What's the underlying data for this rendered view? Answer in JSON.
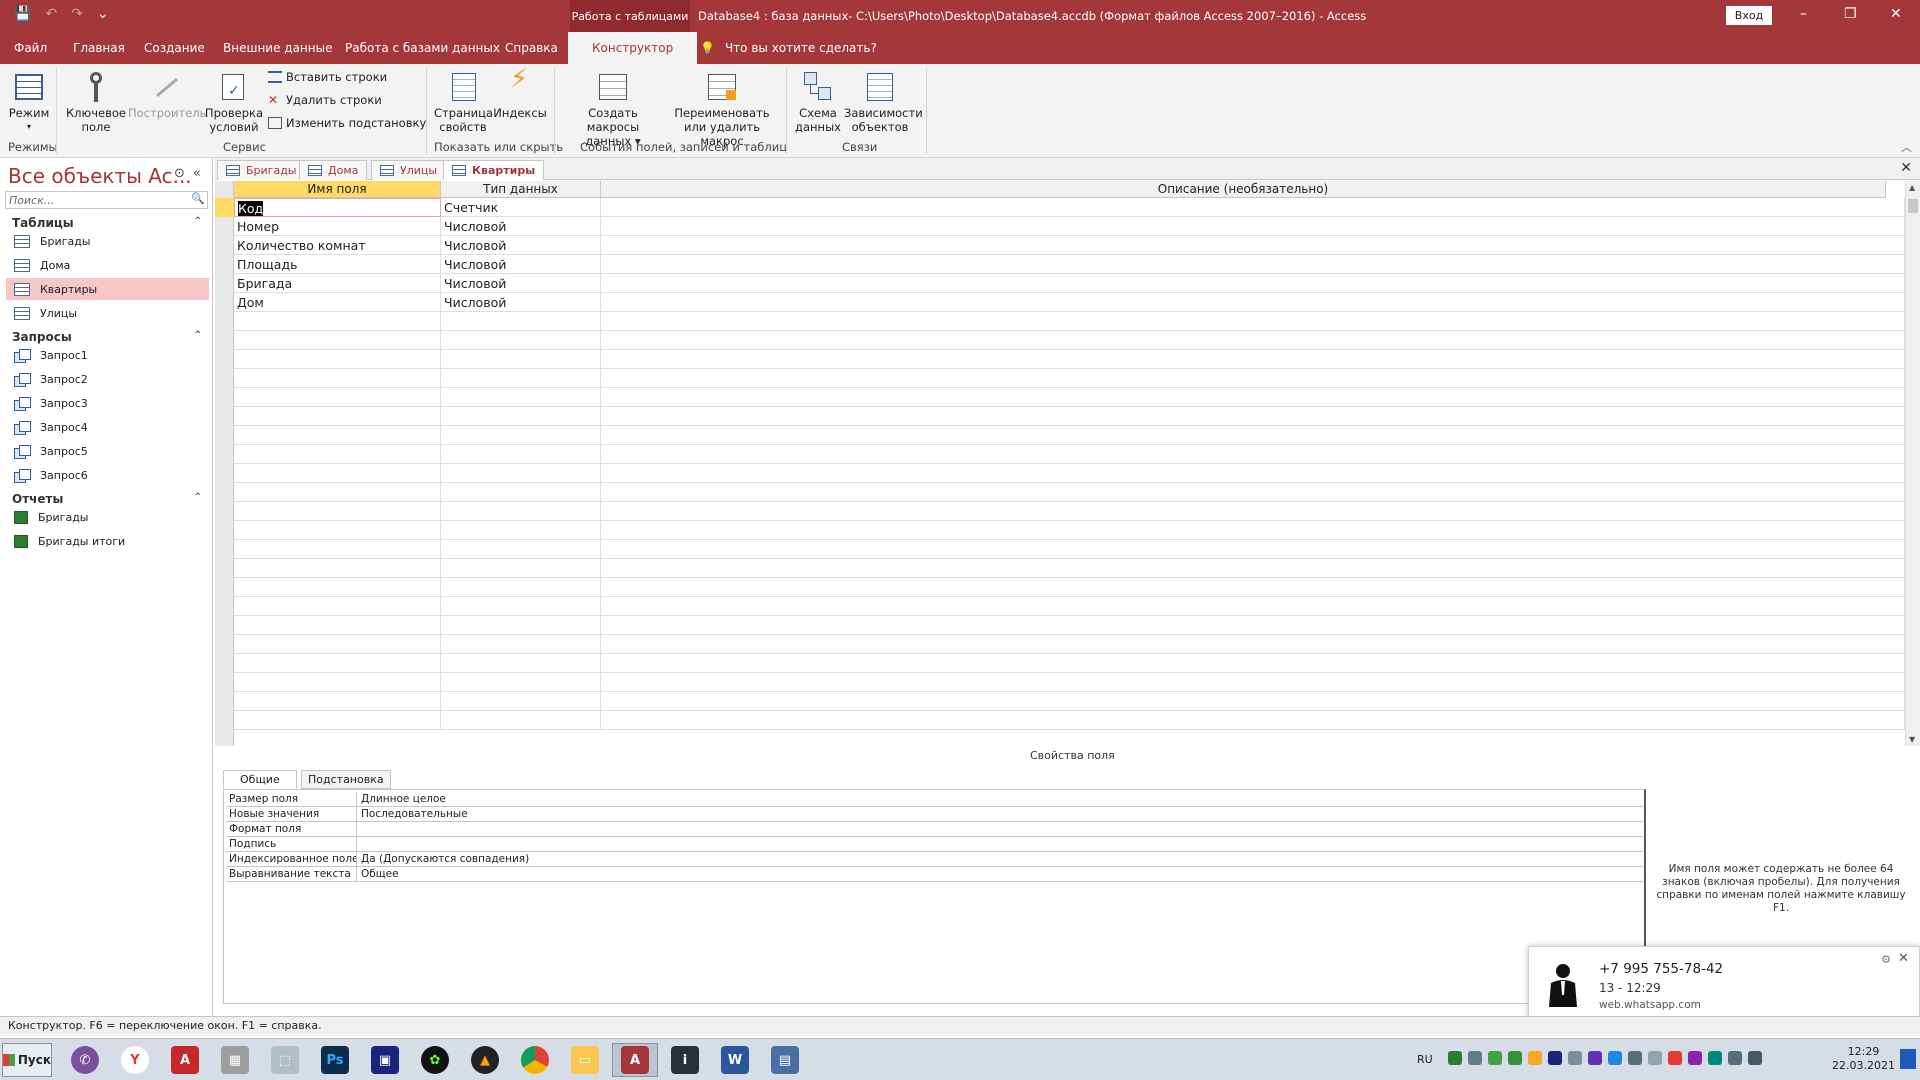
{
  "titlebar": {
    "context_tab": "Работа с таблицами",
    "title": "Database4 : база данных- C:\\Users\\Photo\\Desktop\\Database4.accdb (Формат файлов Access 2007–2016)  -  Access",
    "signin": "Вход",
    "minimize": "–",
    "restore": "❐",
    "close": "✕"
  },
  "ribbon_tabs": {
    "file": "Файл",
    "home": "Главная",
    "create": "Создание",
    "external": "Внешние данные",
    "dbtools": "Работа с базами данных",
    "help": "Справка",
    "design": "Конструктор",
    "tellme": "Что вы хотите сделать?"
  },
  "ribbon": {
    "mode": "Режим",
    "primary_key_1": "Ключевое",
    "primary_key_2": "поле",
    "builder": "Построитель",
    "test_rules_1": "Проверка",
    "test_rules_2": "условий",
    "insert_rows": "Вставить строки",
    "delete_rows": "Удалить строки",
    "modify_lookups": "Изменить подстановку",
    "property_sheet_1": "Страница",
    "property_sheet_2": "свойств",
    "indexes": "Индексы",
    "create_macros_1": "Создать макросы",
    "create_macros_2": "данных",
    "rename_macro_1": "Переименовать",
    "rename_macro_2": "или удалить макрос",
    "relationships_1": "Схема",
    "relationships_2": "данных",
    "dependencies_1": "Зависимости",
    "dependencies_2": "объектов",
    "grp_views": "Режимы",
    "grp_tools": "Сервис",
    "grp_showhide": "Показать или скрыть",
    "grp_events": "События полей, записей и таблиц",
    "grp_relationships": "Связи"
  },
  "nav": {
    "header": "Все объекты Ac...",
    "search_placeholder": "Поиск...",
    "sections": {
      "tables": "Таблицы",
      "queries": "Запросы",
      "reports": "Отчеты"
    },
    "tables": [
      "Бригады",
      "Дома",
      "Квартиры",
      "Улицы"
    ],
    "queries": [
      "Запрос1",
      "Запрос2",
      "Запрос3",
      "Запрос4",
      "Запрос5",
      "Запрос6"
    ],
    "reports": [
      "Бригады",
      "Бригады итоги"
    ]
  },
  "doc_tabs": [
    "Бригады",
    "Дома",
    "Улицы",
    "Квартиры"
  ],
  "grid": {
    "headers": {
      "field_name": "Имя поля",
      "data_type": "Тип данных",
      "description": "Описание (необязательно)"
    },
    "rows": [
      {
        "name": "Код",
        "type": "Счетчик"
      },
      {
        "name": "Номер",
        "type": "Числовой"
      },
      {
        "name": "Количество комнат",
        "type": "Числовой"
      },
      {
        "name": "Площадь",
        "type": "Числовой"
      },
      {
        "name": "Бригада",
        "type": "Числовой"
      },
      {
        "name": "Дом",
        "type": "Числовой"
      }
    ]
  },
  "field_props": {
    "title": "Свойства поля",
    "tab_general": "Общие",
    "tab_lookup": "Подстановка",
    "rows": [
      {
        "k": "Размер поля",
        "v": "Длинное целое"
      },
      {
        "k": "Новые значения",
        "v": "Последовательные"
      },
      {
        "k": "Формат поля",
        "v": ""
      },
      {
        "k": "Подпись",
        "v": ""
      },
      {
        "k": "Индексированное поле",
        "v": "Да (Допускаются совпадения)"
      },
      {
        "k": "Выравнивание текста",
        "v": "Общее"
      }
    ],
    "help": "Имя поля может содержать не более 64 знаков (включая пробелы). Для получения справки по именам полей нажмите клавишу F1."
  },
  "notification": {
    "phone": "+7 995 755-78-42",
    "message": "13 - 12:29",
    "source": "web.whatsapp.com"
  },
  "statusbar": {
    "text": "Конструктор.  F6 = переключение окон.  F1 = справка."
  },
  "taskbar": {
    "start": "Пуск",
    "lang": "RU",
    "time": "12:29",
    "date": "22.03.2021"
  }
}
